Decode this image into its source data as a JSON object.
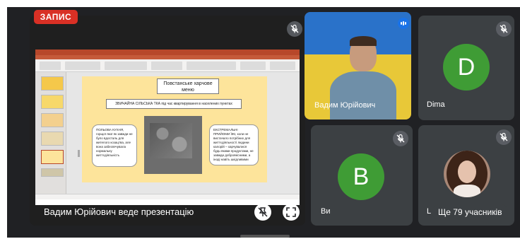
{
  "recording_badge": "ЗАПИС",
  "presentation": {
    "caption": "Вадим Юрійович веде презентацію",
    "slide": {
      "title": "Повстанське харчове меню",
      "subtitle": "ЗВИЧАЙНА СІЛЬСЬКА ТКА під час квартирування в населених пунктах",
      "left_box": "ПОЛЬОВА КУХНЯ, горщої якої як завжди не було вдосталь для жителого козацтва, але вона забезпечувала нормальну життєдіяльність",
      "right_box": "ЕКСТРЕМАЛЬНІ ПРИЙОМИ ЇЖІ, коли не вистачало потрібних для життєдіяльності людини калорій – харчувалися будь-якими продуктами, не завжди доброякісними, а іноді навіть шкідливими"
    }
  },
  "participants": [
    {
      "name": "Вадим Юрійович",
      "avatar_letter": "",
      "video": true,
      "speaking": true
    },
    {
      "name": "Dima",
      "avatar_letter": "D",
      "video": false,
      "muted": true,
      "avatar_color": "#3f9c35"
    },
    {
      "name": "Ви",
      "avatar_letter": "B",
      "video": false,
      "muted": true,
      "avatar_color": "#3f9c35"
    },
    {
      "name": "L",
      "avatar_letter": "",
      "video": false,
      "muted": true
    }
  ],
  "more_participants": "Ще 79 учасників",
  "icons": {
    "mic_off": "mic-off-icon",
    "pin": "pin-off-icon",
    "fullscreen": "fullscreen-icon",
    "speaking": "audio-level-icon"
  }
}
